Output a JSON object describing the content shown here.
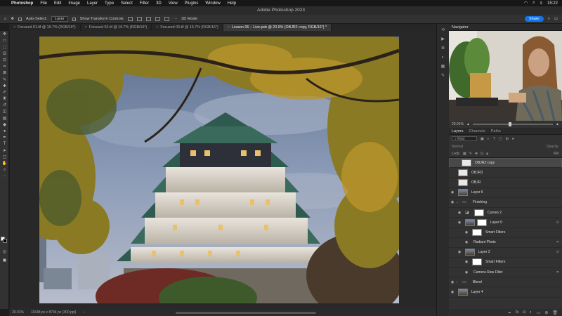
{
  "menubar": {
    "app": "Photoshop",
    "items": [
      "File",
      "Edit",
      "Image",
      "Layer",
      "Type",
      "Select",
      "Filter",
      "3D",
      "View",
      "Plugins",
      "Window",
      "Help"
    ],
    "time": "15:22"
  },
  "window_title": "Adobe Photoshop 2023",
  "options": {
    "auto_select_label": "Auto-Select:",
    "auto_select_value": "Layer",
    "transform_label": "Show Transform Controls",
    "share_label": "Share"
  },
  "tabs": [
    {
      "label": "Focused 01.tif @ 16.7% (RGB/16*)"
    },
    {
      "label": "Focused 02.tif @ 16.7% (RGB/16*)"
    },
    {
      "label": "Focused 03.tif @ 16.7% (RGB/16*)"
    },
    {
      "label": "Lesson 06 – Live.psb @ 20.9% (OBJR2 copy, RGB/16*) *"
    }
  ],
  "status": {
    "zoom": "20.91%",
    "doc_info": "11648 px x 8734 px (300 ppi)"
  },
  "navigator": {
    "title": "Navigator",
    "zoom": "20.91%"
  },
  "layers_panel": {
    "tabs": [
      "Layers",
      "Channels",
      "Paths"
    ],
    "kind_label": "Kind",
    "mode": "Normal",
    "opacity_label": "Opacity:",
    "lock_label": "Lock:",
    "fill_label": "Fill:",
    "layers": [
      {
        "name": "OBJR2 copy",
        "selected": true
      },
      {
        "name": "OBJR3"
      },
      {
        "name": "OBJR"
      },
      {
        "name": "Layer 6"
      },
      {
        "name": "Finishing"
      },
      {
        "name": "Curves 2"
      },
      {
        "name": "Layer 9"
      },
      {
        "name": "Smart Filters"
      },
      {
        "name": "Radiant Photo"
      },
      {
        "name": "Layer 2"
      },
      {
        "name": "Smart Filters"
      },
      {
        "name": "Camera Raw Filter"
      },
      {
        "name": "Blend"
      },
      {
        "name": "Layer 4"
      }
    ]
  },
  "colors": {
    "accent": "#1473e6",
    "panel_bg": "#323232",
    "canvas_bg": "#282828"
  }
}
